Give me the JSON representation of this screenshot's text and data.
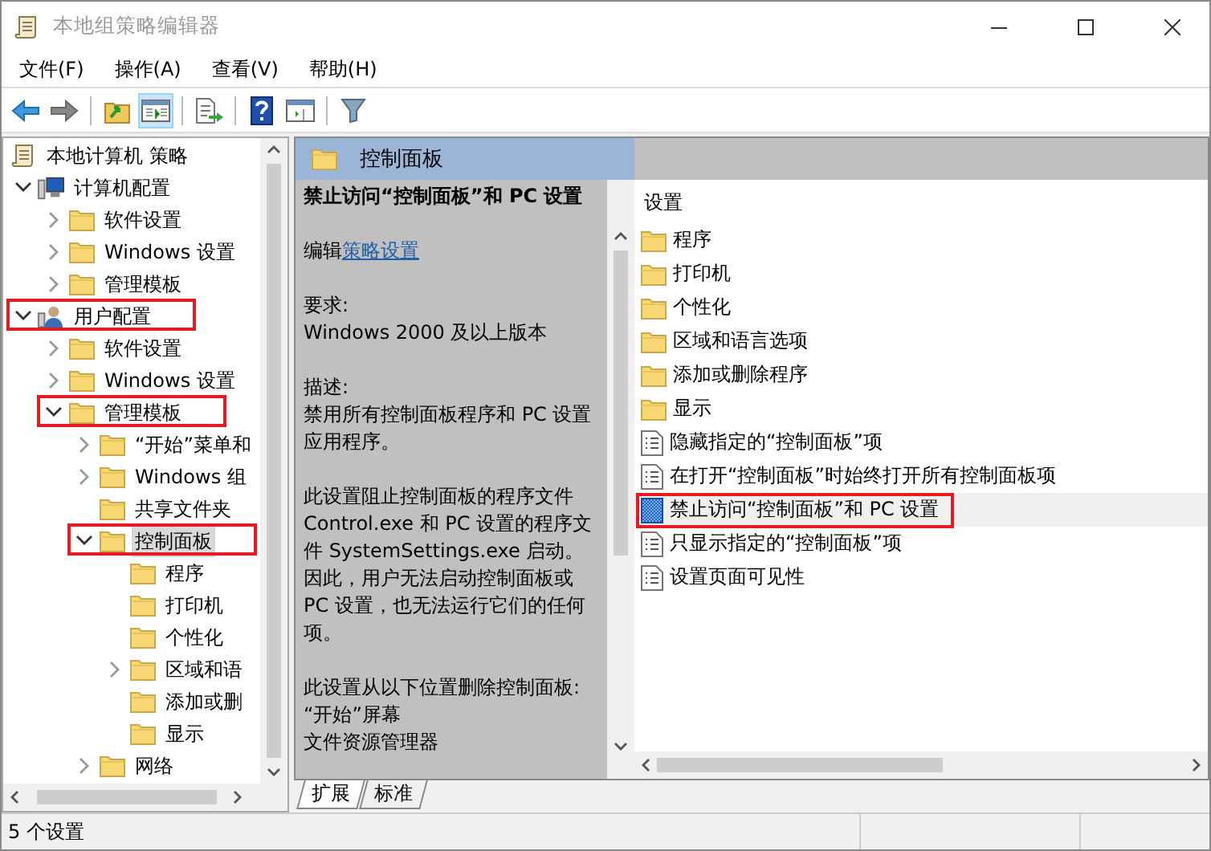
{
  "window": {
    "title": "本地组策略编辑器"
  },
  "menu": [
    "文件(F)",
    "操作(A)",
    "查看(V)",
    "帮助(H)"
  ],
  "toolbar": [
    {
      "kind": "back",
      "pressed": false
    },
    {
      "kind": "forward",
      "pressed": false
    },
    {
      "kind": "sep"
    },
    {
      "kind": "up-folder",
      "pressed": false
    },
    {
      "kind": "tree-pane",
      "pressed": true
    },
    {
      "kind": "sep"
    },
    {
      "kind": "export",
      "pressed": false
    },
    {
      "kind": "sep"
    },
    {
      "kind": "help",
      "pressed": false
    },
    {
      "kind": "action-pane",
      "pressed": false
    },
    {
      "kind": "sep"
    },
    {
      "kind": "filter",
      "pressed": false
    }
  ],
  "tree": [
    {
      "label": "本地计算机 策略",
      "kind": "scroll",
      "selected": false,
      "highlighted": false,
      "children": [
        {
          "label": "计算机配置",
          "kind": "computer",
          "expanded": true,
          "selected": false,
          "highlighted": false,
          "children": [
            {
              "label": "软件设置",
              "kind": "folder",
              "expanded": false,
              "selected": false,
              "highlighted": false
            },
            {
              "label": "Windows 设置",
              "kind": "folder",
              "expanded": false,
              "selected": false,
              "highlighted": false
            },
            {
              "label": "管理模板",
              "kind": "folder",
              "expanded": false,
              "selected": false,
              "highlighted": false
            }
          ]
        },
        {
          "label": "用户配置",
          "kind": "user",
          "expanded": true,
          "selected": false,
          "highlighted": true,
          "children": [
            {
              "label": "软件设置",
              "kind": "folder",
              "expanded": false,
              "selected": false,
              "highlighted": false
            },
            {
              "label": "Windows 设置",
              "kind": "folder",
              "expanded": false,
              "selected": false,
              "highlighted": false
            },
            {
              "label": "管理模板",
              "kind": "folder",
              "expanded": true,
              "selected": false,
              "highlighted": true,
              "children": [
                {
                  "label": "“开始”菜单和",
                  "kind": "folder",
                  "expanded": false,
                  "selected": false,
                  "highlighted": false
                },
                {
                  "label": "Windows 组",
                  "kind": "folder",
                  "expanded": false,
                  "selected": false,
                  "highlighted": false
                },
                {
                  "label": "共享文件夹",
                  "kind": "folder",
                  "selected": false,
                  "highlighted": false
                },
                {
                  "label": "控制面板",
                  "kind": "folder",
                  "expanded": true,
                  "selected": true,
                  "highlighted": true,
                  "children": [
                    {
                      "label": "程序",
                      "kind": "folder",
                      "selected": false,
                      "highlighted": false
                    },
                    {
                      "label": "打印机",
                      "kind": "folder",
                      "selected": false,
                      "highlighted": false
                    },
                    {
                      "label": "个性化",
                      "kind": "folder",
                      "selected": false,
                      "highlighted": false
                    },
                    {
                      "label": "区域和语",
                      "kind": "folder",
                      "expanded": false,
                      "selected": false,
                      "highlighted": false
                    },
                    {
                      "label": "添加或删",
                      "kind": "folder",
                      "selected": false,
                      "highlighted": false
                    },
                    {
                      "label": "显示",
                      "kind": "folder",
                      "selected": false,
                      "highlighted": false
                    }
                  ]
                },
                {
                  "label": "网络",
                  "kind": "folder",
                  "expanded": false,
                  "selected": false,
                  "highlighted": false
                }
              ]
            }
          ]
        }
      ]
    }
  ],
  "header": {
    "title": "控制面板"
  },
  "description": {
    "title": "禁止访问“控制面板”和 PC 设置",
    "edit_prefix": "编辑",
    "edit_link": "策略设置",
    "paragraphs": [
      [
        "要求:",
        "Windows 2000 及以上版本"
      ],
      [
        "描述:",
        "禁用所有控制面板程序和 PC 设置应用程序。"
      ],
      [
        "此设置阻止控制面板的程序文件 Control.exe 和 PC 设置的程序文件 SystemSettings.exe 启动。因此，用户无法启动控制面板或 PC 设置，也无法运行它们的任何项。"
      ],
      [
        "此设置从以下位置删除控制面板:",
        "“开始”屏幕",
        "文件资源管理器"
      ]
    ]
  },
  "list": {
    "column": "设置",
    "items": [
      {
        "label": "程序",
        "kind": "folder",
        "selected": false,
        "highlighted": false
      },
      {
        "label": "打印机",
        "kind": "folder",
        "selected": false,
        "highlighted": false
      },
      {
        "label": "个性化",
        "kind": "folder",
        "selected": false,
        "highlighted": false
      },
      {
        "label": "区域和语言选项",
        "kind": "folder",
        "selected": false,
        "highlighted": false
      },
      {
        "label": "添加或删除程序",
        "kind": "folder",
        "selected": false,
        "highlighted": false
      },
      {
        "label": "显示",
        "kind": "folder",
        "selected": false,
        "highlighted": false
      },
      {
        "label": "隐藏指定的“控制面板”项",
        "kind": "setting",
        "selected": false,
        "highlighted": false
      },
      {
        "label": "在打开“控制面板”时始终打开所有控制面板项",
        "kind": "setting",
        "selected": false,
        "highlighted": false
      },
      {
        "label": "禁止访问“控制面板”和 PC 设置",
        "kind": "setting",
        "selected": true,
        "highlighted": true
      },
      {
        "label": "只显示指定的“控制面板”项",
        "kind": "setting",
        "selected": false,
        "highlighted": false
      },
      {
        "label": "设置页面可见性",
        "kind": "setting",
        "selected": false,
        "highlighted": false
      }
    ]
  },
  "tabs": [
    {
      "label": "扩展",
      "selected": true
    },
    {
      "label": "标准",
      "selected": false
    }
  ],
  "status_bar": {
    "text": "5 个设置"
  }
}
